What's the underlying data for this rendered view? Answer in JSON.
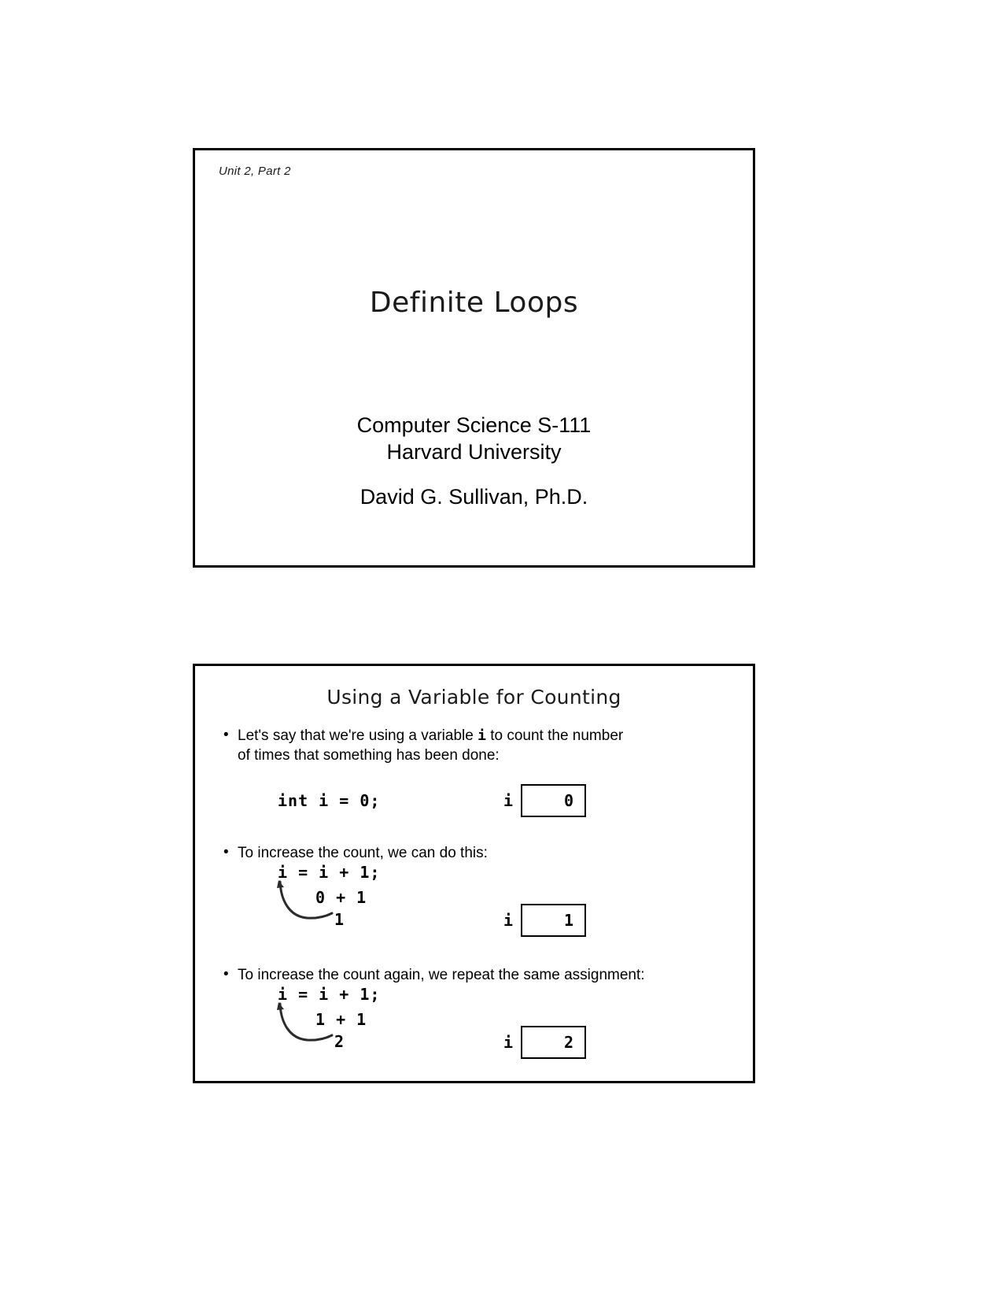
{
  "document": {
    "type": "lecture-slide-handout",
    "page_background": "#ffffff",
    "slide_border_color": "#000000"
  },
  "slide1": {
    "header": "Unit 2, Part 2",
    "title": "Definite Loops",
    "course": "Computer Science S-111",
    "institution": "Harvard University",
    "author": "David G. Sullivan, Ph.D."
  },
  "slide2": {
    "heading": "Using a Variable for Counting",
    "bullet_marker": "•",
    "bullets": [
      {
        "text_before": "Let's say that we're using a variable",
        "mono": "i",
        "text_after": "to count the number",
        "line2": "of times that something has been done:"
      },
      {
        "text": "To increase the count, we can do this:"
      },
      {
        "text": "To increase the count again, we repeat the same assignment:"
      }
    ],
    "code": {
      "declaration": "int i = 0;",
      "assignment_1": "i = i + 1;",
      "expansion_1": "0 + 1",
      "result_1": "1",
      "assignment_2": "i = i + 1;",
      "expansion_2": "1 + 1",
      "result_2": "2"
    },
    "variables": [
      {
        "label": "i",
        "value": "0"
      },
      {
        "label": "i",
        "value": "1"
      },
      {
        "label": "i",
        "value": "2"
      }
    ]
  }
}
